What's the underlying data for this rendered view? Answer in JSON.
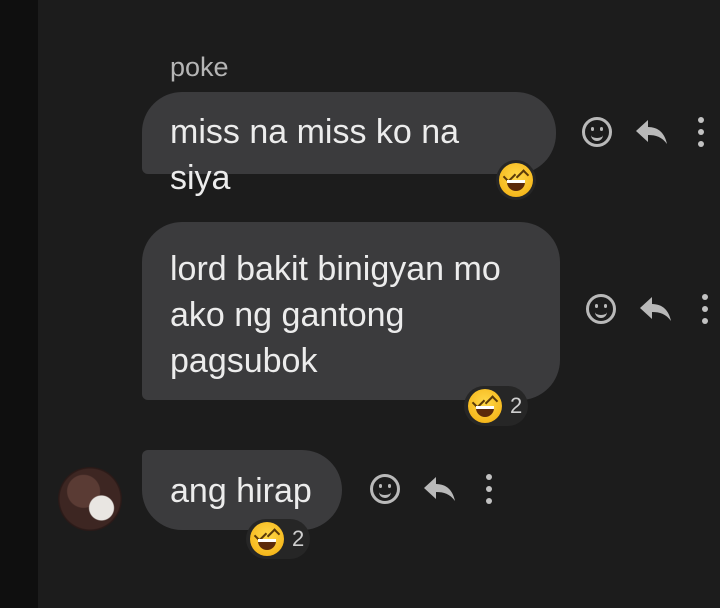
{
  "sender_name": "poke",
  "messages": [
    {
      "text": "miss na miss ko na siya",
      "reaction_count": ""
    },
    {
      "line1": "lord bakit binigyan mo",
      "line2": "ako ng gantong",
      "line3": "pagsubok",
      "reaction_count": "2"
    },
    {
      "text": "ang hirap",
      "reaction_count": "2"
    }
  ],
  "icons": {
    "reaction": "laughing-squinting-face-emoji",
    "react": "smiley-icon",
    "reply": "reply-arrow-icon",
    "more": "vertical-ellipsis-icon"
  },
  "colors": {
    "background": "#1c1c1c",
    "bubble": "#3b3b3d",
    "text": "#ececec",
    "emoji": "#f6b91e"
  }
}
